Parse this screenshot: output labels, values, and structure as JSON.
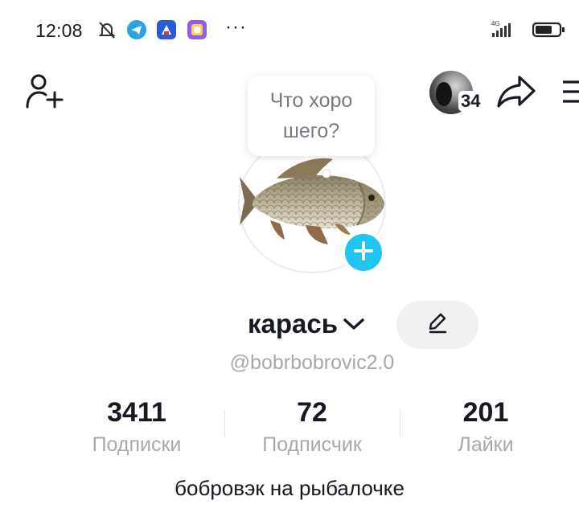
{
  "status_bar": {
    "time": "12:08",
    "icons": [
      "bell-muted-icon",
      "telegram-icon",
      "app-icon",
      "app-icon",
      "more-dots-icon"
    ],
    "more": "···",
    "network_label": "4G"
  },
  "header": {
    "add_friend_icon": "person-add-icon",
    "friends_count": "34",
    "share_icon": "share-arrow-icon",
    "menu_icon": "hamburger-menu-icon"
  },
  "tooltip": {
    "text": "Что хоро шего?"
  },
  "profile": {
    "avatar_icon": "fish-avatar",
    "nickname": "карась",
    "handle": "@bobrbobrovic2.0",
    "bio": "бобровэк на рыбалочке"
  },
  "stats": [
    {
      "value": "3411",
      "label": "Подписки"
    },
    {
      "value": "72",
      "label": "Подписчик"
    },
    {
      "value": "201",
      "label": "Лайки"
    }
  ],
  "colors": {
    "accent": "#20c4f0",
    "text": "#161823",
    "muted": "#a7a8ac"
  }
}
